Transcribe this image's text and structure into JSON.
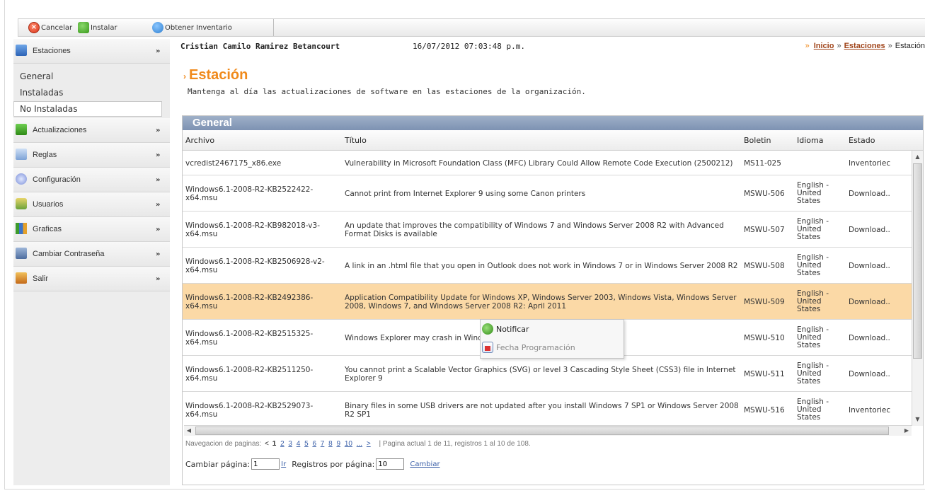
{
  "toolbar": {
    "cancel_label": "Cancelar",
    "install_label": "Instalar",
    "inventory_label": "Obtener Inventario"
  },
  "sidebar": {
    "sections": [
      {
        "label": "Estaciones",
        "icon": "stations-icon"
      },
      {
        "label": "Actualizaciones",
        "icon": "updates-icon"
      },
      {
        "label": "Reglas",
        "icon": "rules-icon"
      },
      {
        "label": "Configuración",
        "icon": "config-icon"
      },
      {
        "label": "Usuarios",
        "icon": "users-icon"
      },
      {
        "label": "Graficas",
        "icon": "charts-icon"
      },
      {
        "label": "Cambiar Contraseña",
        "icon": "password-icon"
      },
      {
        "label": "Salir",
        "icon": "exit-icon"
      }
    ],
    "expand_glyph": "»",
    "sub_items": [
      "General",
      "Instaladas",
      "No Instaladas"
    ]
  },
  "header": {
    "user": "Cristian Camilo Ramirez Betancourt",
    "datetime": "16/07/2012 07:03:48 p.m.",
    "breadcrumb": {
      "arrow": "»",
      "home": "Inicio",
      "sep": "»",
      "section": "Estaciones",
      "current": "Estación"
    }
  },
  "page": {
    "title_prefix": "›",
    "title": "Estación",
    "subtitle": "Mantenga al día las actualizaciones de software en las estaciones de la organización."
  },
  "grid": {
    "title": "General",
    "columns": [
      "Archivo",
      "Título",
      "Boletin",
      "Idioma",
      "Estado"
    ],
    "rows": [
      {
        "archivo": "vcredist2467175_x86.exe",
        "titulo": "Vulnerability in Microsoft Foundation Class (MFC) Library Could Allow Remote Code Execution (2500212)",
        "boletin": "MS11-025",
        "idioma": "",
        "estado": "Inventoriec"
      },
      {
        "archivo": "Windows6.1-2008-R2-KB2522422-x64.msu",
        "titulo": "Cannot print from Internet Explorer 9 using some Canon printers",
        "boletin": "MSWU-506",
        "idioma": "English - United States",
        "estado": "Download.."
      },
      {
        "archivo": "Windows6.1-2008-R2-KB982018-v3-x64.msu",
        "titulo": "An update that improves the compatibility of Windows 7 and Windows Server 2008 R2 with Advanced Format Disks is available",
        "boletin": "MSWU-507",
        "idioma": "English - United States",
        "estado": "Download.."
      },
      {
        "archivo": "Windows6.1-2008-R2-KB2506928-v2-x64.msu",
        "titulo": "A link in an .html file that you open in Outlook does not work in Windows 7 or in Windows Server 2008 R2",
        "boletin": "MSWU-508",
        "idioma": "English - United States",
        "estado": "Download.."
      },
      {
        "archivo": "Windows6.1-2008-R2-KB2492386-x64.msu",
        "titulo": "Application Compatibility Update for Windows XP, Windows Server 2003, Windows Vista, Windows Server 2008, Windows 7, and Windows Server 2008 R2: April 2011",
        "boletin": "MSWU-509",
        "idioma": "English - United States",
        "estado": "Download.."
      },
      {
        "archivo": "Windows6.1-2008-R2-KB2515325-x64.msu",
        "titulo": "Windows Explorer may crash in Windows 7 or in Windows Server 2008 R2",
        "boletin": "MSWU-510",
        "idioma": "English - United States",
        "estado": "Download.."
      },
      {
        "archivo": "Windows6.1-2008-R2-KB2511250-x64.msu",
        "titulo": "You cannot print a Scalable Vector Graphics (SVG) or level 3 Cascading Style Sheet (CSS3) file in Internet Explorer 9",
        "boletin": "MSWU-511",
        "idioma": "English - United States",
        "estado": "Download.."
      },
      {
        "archivo": "Windows6.1-2008-R2-KB2529073-x64.msu",
        "titulo": "Binary files in some USB drivers are not updated after you install Windows 7 SP1 or Windows Server 2008 R2 SP1",
        "boletin": "MSWU-516",
        "idioma": "English - United States",
        "estado": "Inventoriec"
      }
    ],
    "selected_row": 4
  },
  "context_menu": {
    "items": [
      {
        "label": "Notificar",
        "enabled": true
      },
      {
        "label": "Fecha Programación",
        "enabled": false
      }
    ]
  },
  "pager": {
    "label": "Navegacion de paginas:",
    "prev": "<",
    "pages": [
      "1",
      "2",
      "3",
      "4",
      "5",
      "6",
      "7",
      "8",
      "9",
      "10",
      "...",
      ">"
    ],
    "info": "|  Pagina actual 1 de 11, registros 1 al 10 de 108."
  },
  "changer": {
    "page_label": "Cambiar página:",
    "page_value": "1",
    "go_label": "Ir",
    "per_page_label": "Registros por página:",
    "per_page_value": "10",
    "change_label": "Cambiar"
  },
  "colors": {
    "accent": "#f08a1c",
    "grid_header": "#8a9cba",
    "selected_row": "#fbd9a6",
    "link": "#3a5fa8"
  }
}
